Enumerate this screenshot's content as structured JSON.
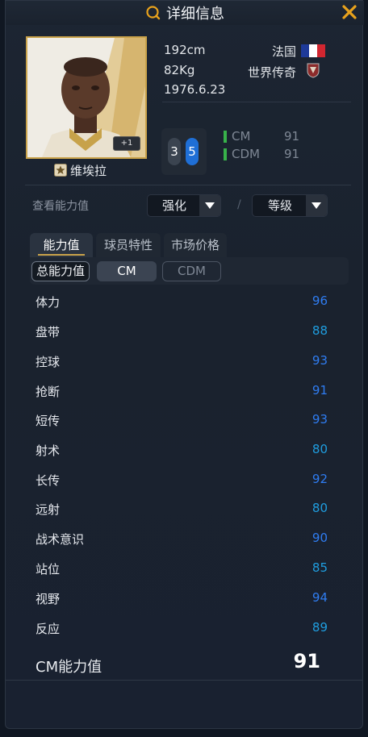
{
  "header": {
    "title": "详细信息"
  },
  "player": {
    "name": "维埃拉",
    "height": "192cm",
    "weight": "82Kg",
    "birthday": "1976.6.23",
    "nation": "法国",
    "season": "世界传奇",
    "plus_badge": "+1"
  },
  "foot": {
    "weak": "3",
    "strong": "5"
  },
  "positions": [
    {
      "name": "CM",
      "rating": "91"
    },
    {
      "name": "CDM",
      "rating": "91"
    }
  ],
  "view": {
    "label": "查看能力值",
    "enhance_dropdown": "强化",
    "level_dropdown": "等级",
    "separator": "/"
  },
  "tabs": [
    {
      "label": "能力值",
      "active": true
    },
    {
      "label": "球员特性",
      "active": false
    },
    {
      "label": "市场价格",
      "active": false
    }
  ],
  "sub_tabs": [
    {
      "label": "总能力值"
    },
    {
      "label": "CM"
    },
    {
      "label": "CDM"
    }
  ],
  "stats": [
    {
      "label": "体力",
      "value": "96",
      "color": "#2f7df2"
    },
    {
      "label": "盘带",
      "value": "88",
      "color": "#1f9ee0"
    },
    {
      "label": "控球",
      "value": "93",
      "color": "#2f7df2"
    },
    {
      "label": "抢断",
      "value": "91",
      "color": "#2f7df2"
    },
    {
      "label": "短传",
      "value": "93",
      "color": "#2f7df2"
    },
    {
      "label": "射术",
      "value": "80",
      "color": "#1f9ee0"
    },
    {
      "label": "长传",
      "value": "92",
      "color": "#2f7df2"
    },
    {
      "label": "远射",
      "value": "80",
      "color": "#1f9ee0"
    },
    {
      "label": "战术意识",
      "value": "90",
      "color": "#2f7df2"
    },
    {
      "label": "站位",
      "value": "85",
      "color": "#1f9ee0"
    },
    {
      "label": "视野",
      "value": "94",
      "color": "#2f7df2"
    },
    {
      "label": "反应",
      "value": "89",
      "color": "#1f9ee0"
    }
  ],
  "total": {
    "label": "CM能力值",
    "value": "91"
  },
  "colors": {
    "accent_gold": "#e8a21c",
    "position_green": "#38b24a",
    "stat_blue": "#2f7df2",
    "stat_cyan": "#1f9ee0"
  }
}
